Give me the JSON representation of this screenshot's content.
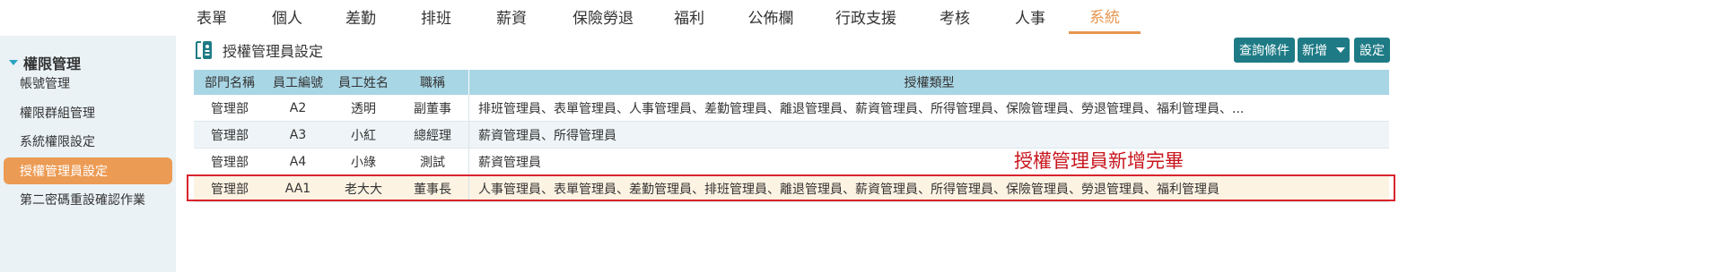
{
  "topnav": {
    "items": [
      "表單",
      "個人",
      "差勤",
      "排班",
      "薪資",
      "保險勞退",
      "福利",
      "公佈欄",
      "行政支援",
      "考核",
      "人事",
      "系統"
    ],
    "active_index": 11
  },
  "sidebar": {
    "group_title": "權限管理",
    "items": [
      "帳號管理",
      "權限群組管理",
      "系統權限設定",
      "授權管理員設定",
      "第二密碼重設確認作業"
    ],
    "active_index": 3
  },
  "page": {
    "title": "授權管理員設定"
  },
  "toolbar": {
    "query_label": "查詢條件",
    "add_label": "新增",
    "settings_label": "設定"
  },
  "table": {
    "headers": [
      "部門名稱",
      "員工編號",
      "員工姓名",
      "職稱",
      "授權類型"
    ],
    "rows": [
      [
        "管理部",
        "A2",
        "透明",
        "副董事",
        "排班管理員、表單管理員、人事管理員、差勤管理員、離退管理員、薪資管理員、所得管理員、保險管理員、勞退管理員、福利管理員、..."
      ],
      [
        "管理部",
        "A3",
        "小紅",
        "總經理",
        "薪資管理員、所得管理員"
      ],
      [
        "管理部",
        "A4",
        "小綠",
        "測試",
        "薪資管理員"
      ],
      [
        "管理部",
        "AA1",
        "老大大",
        "董事長",
        "人事管理員、表單管理員、差勤管理員、排班管理員、離退管理員、薪資管理員、所得管理員、保險管理員、勞退管理員、福利管理員"
      ]
    ]
  },
  "annotation": {
    "text": "授權管理員新增完畢"
  },
  "colors": {
    "accent_orange": "#e8964f",
    "button_teal": "#1e7b86",
    "header_blue": "#a9d6e5",
    "highlight_red": "#d9232d"
  }
}
